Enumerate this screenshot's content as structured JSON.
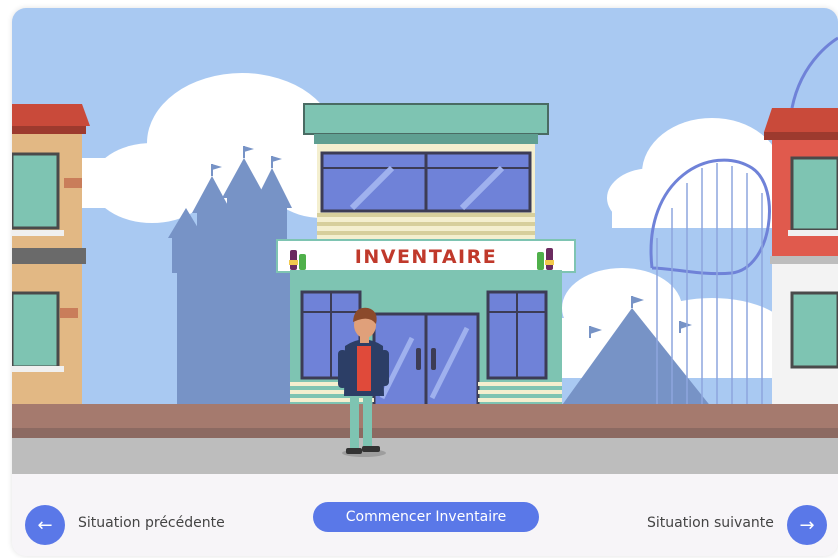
{
  "scene": {
    "shop_sign": "INVENTAIRE",
    "colors": {
      "sky": "#a9c9f2",
      "cloud": "#ffffff",
      "castle": "#7793c6",
      "shop_teal": "#7ec4b2",
      "window_blue": "#6f82d8",
      "sign_red": "#c0392b",
      "ground": "#a57a6e",
      "sidewalk": "#bdbdbd"
    }
  },
  "nav": {
    "prev_label": "Situation précédente",
    "next_label": "Situation suivante",
    "start_label": "Commencer Inventaire",
    "prev_icon": "←",
    "next_icon": "→",
    "accent": "#5a78e8"
  }
}
